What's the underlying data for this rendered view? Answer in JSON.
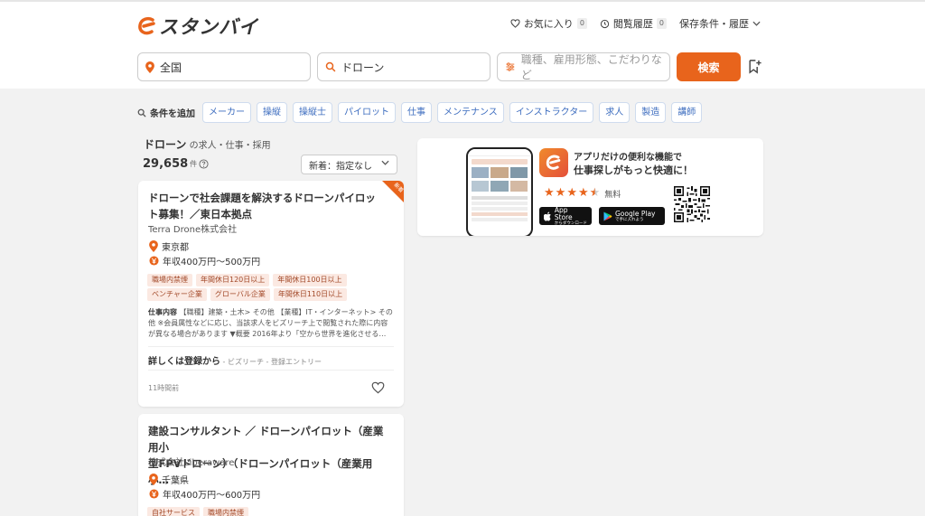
{
  "header": {
    "logo_text": "スタンバイ",
    "favorites_label": "お気に入り",
    "favorites_count": "0",
    "history_label": "閲覧履歴",
    "history_count": "0",
    "saved_label": "保存条件・履歴"
  },
  "search": {
    "location_value": "全国",
    "keyword_value": "ドローン",
    "filter_placeholder": "職種、雇用形態、こだわりなど",
    "search_button": "検索"
  },
  "conditions": {
    "add_label": "条件を追加",
    "chips": [
      "メーカー",
      "操縦",
      "操縦士",
      "パイロット",
      "仕事",
      "メンテナンス",
      "インストラクター",
      "求人",
      "製造",
      "講師"
    ]
  },
  "results": {
    "keyword": "ドローン",
    "suffix": "の求人・仕事・採用",
    "count": "29,658",
    "count_unit": "件",
    "sort_label": "新着：指定なし"
  },
  "jobs": [
    {
      "badge": "新着",
      "title": "ドローンで社会課題を解決するドローンパイロット募集！／東日本拠点",
      "company": "Terra Drone株式会社",
      "location": "東京都",
      "salary": "年収400万円～500万円",
      "features_row1": [
        "職場内禁煙",
        "年間休日120日以上",
        "年間休日100日以上"
      ],
      "features_row2": [
        "ベンチャー企業",
        "グローバル企業",
        "年間休日110日以上"
      ],
      "desc_label": "仕事内容",
      "desc_line1": "【職種】建築・土木> その他 【業種】IT・インターネット> その",
      "desc_line2": "他 ※会員属性などに応じ、当該求人をビズリーチ上で閲覧された際に内容",
      "desc_line3": "が異なる場合があります ▼概要 2016年より「空から世界を進化させる…",
      "more_label": "詳しくは登録から",
      "more_source": " - ビズリーチ - 登録エントリー",
      "time_ago": "11時間前"
    },
    {
      "title_line1": "建設コンサルタント ／ ドローンパイロット（産業用小",
      "title_line2": "型FPVドローン）（ドローンパイロット（産業用小…",
      "company": "株式会社Liberaware",
      "location": "千葉県",
      "salary": "年収400万円～600万円",
      "features_row1": [
        "自社サービス",
        "職場内禁煙"
      ]
    }
  ],
  "app_banner": {
    "line1": "アプリだけの便利な機能で",
    "line2": "仕事探しがもっと快適に！",
    "rating": 4.5,
    "free_label": "無料",
    "appstore_sub": "からダウンロード",
    "appstore_main": "App Store",
    "googleplay_main": "Google Play",
    "googleplay_sub": "で手に入れよう"
  },
  "colors": {
    "brand": "#e8641c",
    "chip_text": "#3d6dbf",
    "feature_bg": "#fbe9e2"
  }
}
